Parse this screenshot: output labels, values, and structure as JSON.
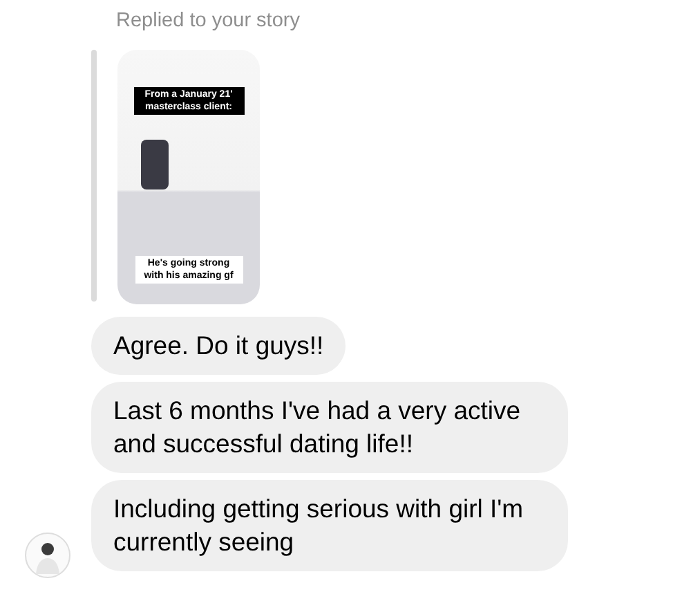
{
  "reply_header": "Replied to your story",
  "story": {
    "caption_top": "From a January 21' masterclass client:",
    "caption_bottom": "He's going strong with his amazing gf"
  },
  "messages": [
    {
      "text": "Agree. Do it guys!!"
    },
    {
      "text": "Last 6 months I've had a very active and successful dating life!!"
    },
    {
      "text": "Including getting serious with girl I'm currently seeing"
    }
  ]
}
